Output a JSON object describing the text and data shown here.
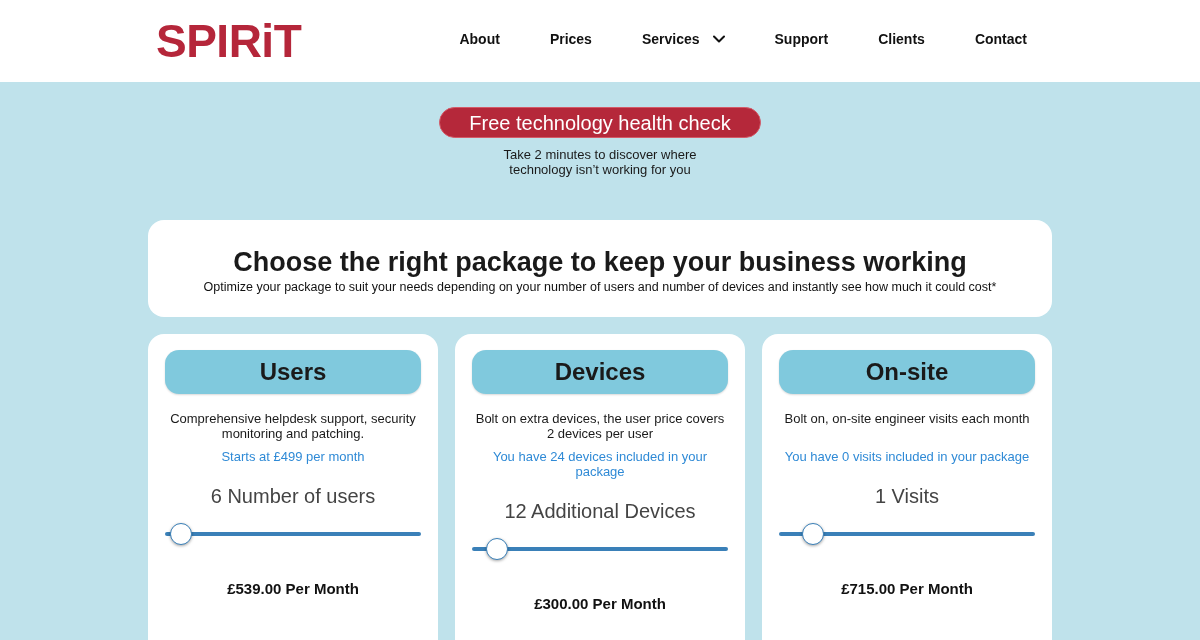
{
  "header": {
    "logo": "SPIRiT",
    "nav": [
      {
        "label": "About",
        "kind": "link"
      },
      {
        "label": "Prices",
        "kind": "link"
      },
      {
        "label": "Services",
        "kind": "dropdown"
      },
      {
        "label": "Support",
        "kind": "link"
      },
      {
        "label": "Clients",
        "kind": "link"
      },
      {
        "label": "Contact",
        "kind": "link"
      }
    ]
  },
  "promo": {
    "button": "Free technology health check",
    "note": "Take 2 minutes to discover where technology isn’t working for you"
  },
  "intro": {
    "title": "Choose the right package to keep your business working",
    "subtitle": "Optimize your package to suit your needs depending on your number of users and number of devices and instantly see how much it could cost*"
  },
  "packages": [
    {
      "title": "Users",
      "description": "Comprehensive helpdesk support, security monitoring and patching.",
      "note": "Starts at £499 per month",
      "value_label": "6 Number of users",
      "level": 0.02,
      "price": "£539.00 Per Month"
    },
    {
      "title": "Devices",
      "description": "Bolt on extra devices, the user price covers 2 devices per user",
      "note": "You have 24 devices included in your package",
      "value_label": "12 Additional Devices",
      "level": 0.06,
      "price": "£300.00 Per Month"
    },
    {
      "title": "On-site",
      "description": "Bolt on, on-site engineer visits each month",
      "note": "You have 0 visits included in your package",
      "value_label": "1 Visits",
      "level": 0.1,
      "price": "£715.00 Per Month"
    }
  ]
}
